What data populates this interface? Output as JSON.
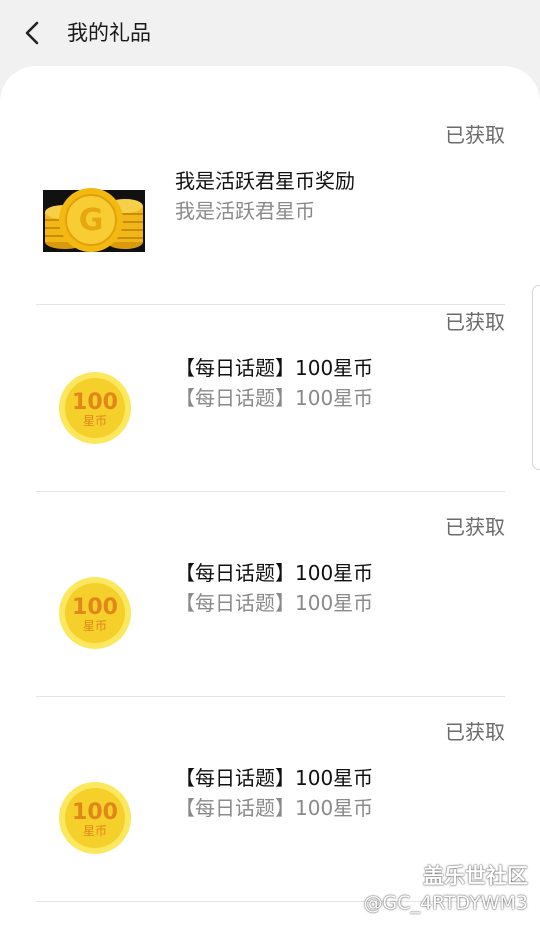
{
  "header": {
    "title": "我的礼品"
  },
  "gifts": [
    {
      "status": "已获取",
      "name": "我是活跃君星币奖励",
      "desc": "我是活跃君星币",
      "icon": "gold-coin-stack-icon"
    },
    {
      "status": "已获取",
      "name": "【每日话题】100星币",
      "desc": "【每日话题】100星币",
      "icon": "100-star-coin-icon",
      "coin_amount": "100",
      "coin_unit": "星币"
    },
    {
      "status": "已获取",
      "name": "【每日话题】100星币",
      "desc": "【每日话题】100星币",
      "icon": "100-star-coin-icon",
      "coin_amount": "100",
      "coin_unit": "星币"
    },
    {
      "status": "已获取",
      "name": "【每日话题】100星币",
      "desc": "【每日话题】100星币",
      "icon": "100-star-coin-icon",
      "coin_amount": "100",
      "coin_unit": "星币"
    }
  ],
  "watermark": {
    "brand": "盖乐世社区",
    "user": "@GC_4RTDYWM3"
  },
  "colors": {
    "background": "#f1f1f1",
    "card": "#ffffff",
    "coin_gold": "#f5cf2a",
    "coin_text": "#e0861a"
  }
}
